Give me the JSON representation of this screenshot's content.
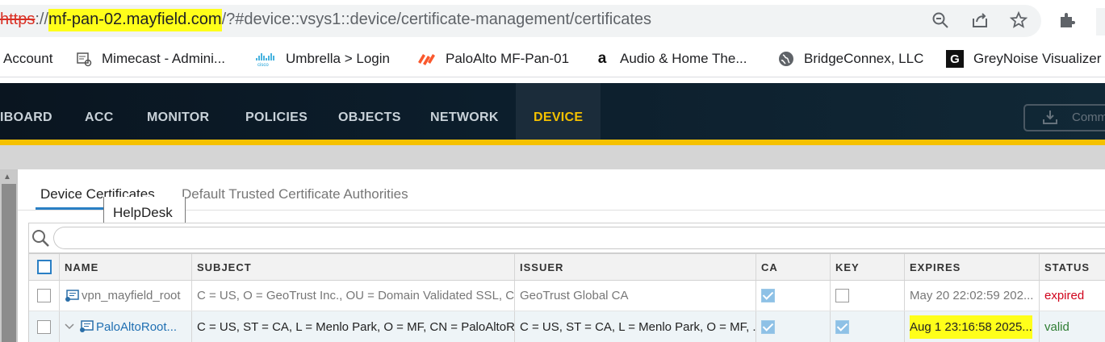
{
  "browser": {
    "url": {
      "scheme": "https",
      "separator": "://",
      "host": "mf-pan-02.mayfield.com",
      "path": "/?#device::vsys1::device/certificate-management/certificates"
    },
    "icons": [
      "zoom-icon",
      "share-icon",
      "star-icon",
      "extensions-icon"
    ]
  },
  "bookmarks": [
    {
      "label": "Account",
      "icon": "none"
    },
    {
      "label": "Mimecast - Admini...",
      "icon": "mimecast-icon"
    },
    {
      "label": "Umbrella > Login",
      "icon": "cisco-icon"
    },
    {
      "label": "PaloAlto MF-Pan-01",
      "icon": "paloalto-icon"
    },
    {
      "label": "Audio & Home The...",
      "icon": "amazon-icon"
    },
    {
      "label": "BridgeConnex, LLC",
      "icon": "globe-icon"
    },
    {
      "label": "GreyNoise Visualizer",
      "icon": "greynoise-icon"
    }
  ],
  "nav": {
    "items": [
      "IBOARD",
      "ACC",
      "MONITOR",
      "POLICIES",
      "OBJECTS",
      "NETWORK",
      "DEVICE"
    ],
    "active": "DEVICE",
    "commit_label": "Commit"
  },
  "tabs": {
    "active": "Device Certificates",
    "inactive": "Default Trusted Certificate Authorities"
  },
  "tooltip": "HelpDesk",
  "search": {
    "placeholder": ""
  },
  "table": {
    "columns": [
      "NAME",
      "SUBJECT",
      "ISSUER",
      "CA",
      "KEY",
      "EXPIRES",
      "STATUS"
    ],
    "rows": [
      {
        "name": "vpn_mayfield_root",
        "subject": "C = US, O = GeoTrust Inc., OU = Domain Validated SSL, C...",
        "issuer": "GeoTrust Global CA",
        "ca": true,
        "key": false,
        "expires": "May 20 22:02:59 202...",
        "status": "expired"
      },
      {
        "name": "PaloAltoRoot...",
        "subject": "C = US, ST = CA, L = Menlo Park, O = MF, CN = PaloAltoR...",
        "issuer": "C = US, ST = CA, L = Menlo Park, O = MF, ...",
        "ca": true,
        "key": true,
        "expires": "Aug 1 23:16:58 2025...",
        "status": "valid"
      }
    ]
  },
  "colors": {
    "nav_active": "#f5c100",
    "highlight": "#ffff1a",
    "status_expired": "#d0021b",
    "status_valid": "#2e7d32",
    "link": "#1f6fb2"
  }
}
